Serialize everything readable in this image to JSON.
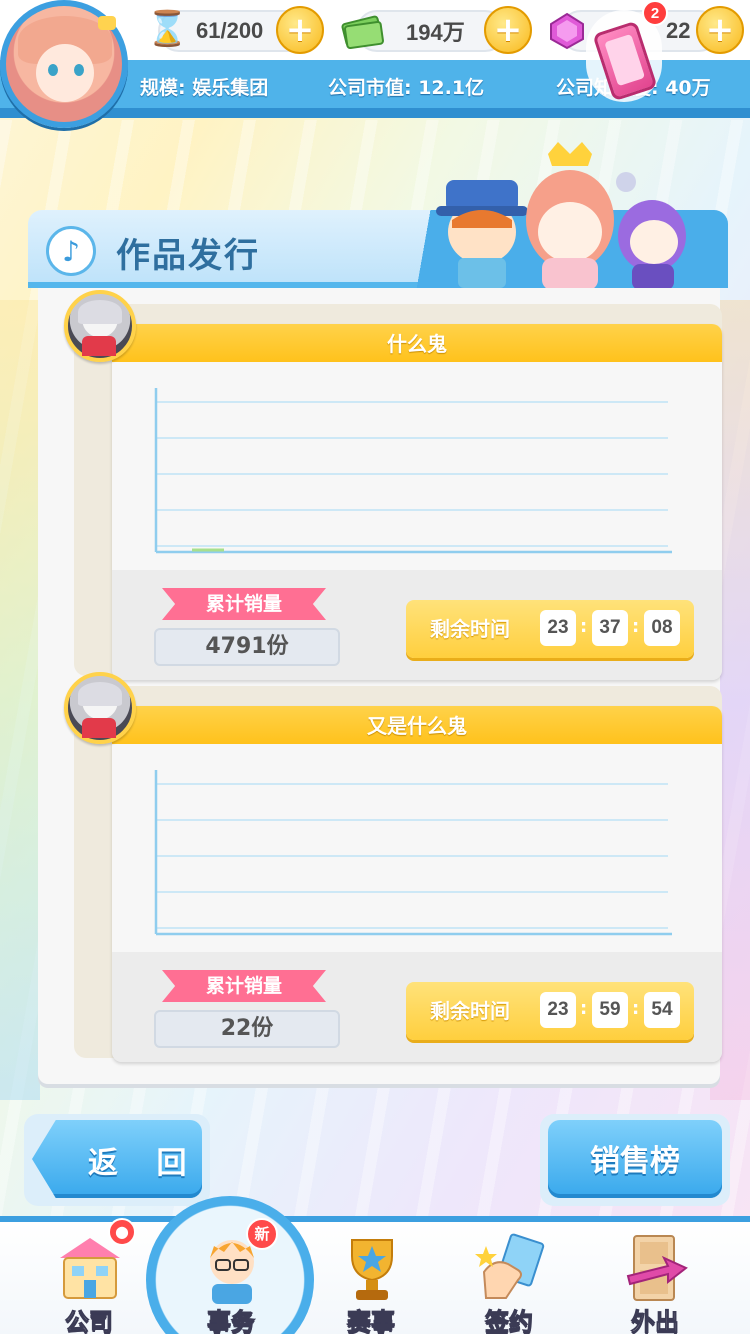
{
  "top_bar": {
    "energy": "61/200",
    "money": "194万",
    "gems": "22",
    "notification_count": "2",
    "scale": "规模: 娱乐集团",
    "market_value": "公司市值: 12.1亿",
    "popularity": "公司知名度: 40万",
    "colors": {
      "bar": "#4fb3ea",
      "plus": "#f9b91c"
    }
  },
  "section": {
    "title": "作品发行",
    "icon": "music-note-icon"
  },
  "works": [
    {
      "name": "什么鬼",
      "sales_label": "累计销量",
      "sales_value": "4791份",
      "timer_label": "剩余时间",
      "hh": "23",
      "mm": "37",
      "ss": "08"
    },
    {
      "name": "又是什么鬼",
      "sales_label": "累计销量",
      "sales_value": "22份",
      "timer_label": "剩余时间",
      "hh": "23",
      "mm": "59",
      "ss": "54"
    }
  ],
  "buttons": {
    "back": "返 回",
    "sales_rank": "销售榜"
  },
  "nav": {
    "items": [
      {
        "label": "公司",
        "icon": "company-building-icon"
      },
      {
        "label": "事务",
        "icon": "affairs-character-icon",
        "badge": "新"
      },
      {
        "label": "赛事",
        "icon": "trophy-icon"
      },
      {
        "label": "签约",
        "icon": "contract-hand-icon"
      },
      {
        "label": "外出",
        "icon": "door-exit-icon"
      }
    ]
  }
}
